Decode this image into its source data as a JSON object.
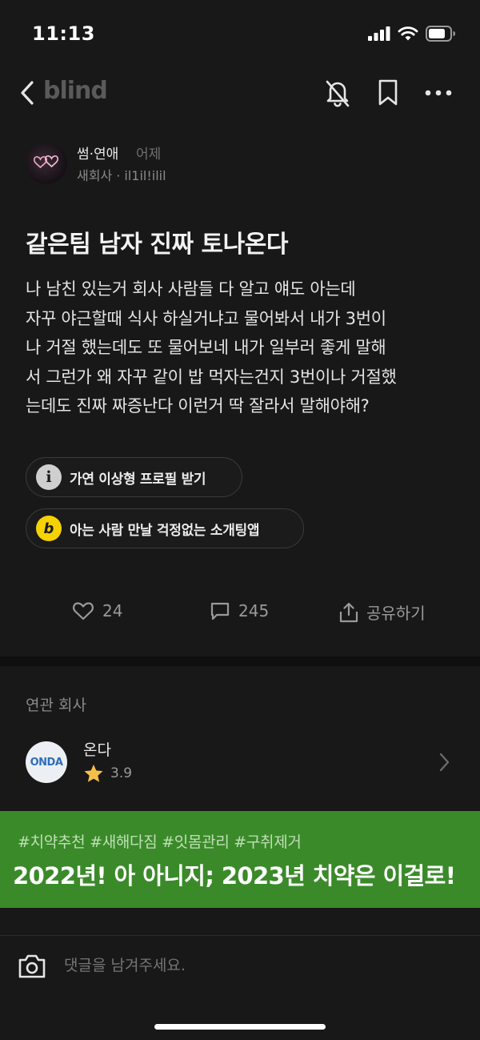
{
  "status_bar": {
    "time": "11:13"
  },
  "nav": {
    "logo": "blind"
  },
  "author": {
    "category": "썸·연애",
    "time": "어제",
    "meta": "새회사 · il1il!ilil"
  },
  "post": {
    "title": "같은팀 남자 진짜 토나온다",
    "body": "나 남친 있는거 회사 사람들 다 알고 얘도 아는데\n자꾸 야근할때 식사 하실거냐고 물어봐서 내가 3번이\n나 거절 했는데도 또 물어보네 내가 일부러 좋게 말해\n서 그런가 왜 자꾸 같이 밥 먹자는건지 3번이나 거절했\n는데도 진짜 짜증난다 이런거 딱 잘라서 말해야해?"
  },
  "promos": [
    {
      "icon": "info-icon",
      "glyph": "i",
      "label": "가연 이상형 프로필 받기"
    },
    {
      "icon": "b-logo-icon",
      "glyph": "b",
      "label": "아는 사람 만날 걱정없는 소개팅앱"
    }
  ],
  "actions": {
    "likes": "24",
    "comments": "245",
    "share_label": "공유하기"
  },
  "related": {
    "title": "연관 회사",
    "company": {
      "logo_text": "ONDA",
      "name": "온다",
      "rating": "3.9"
    }
  },
  "banner": {
    "tags": "#치약추천 #새해다짐 #잇몸관리 #구취제거",
    "headline": "2022년! 아 아니지; 2023년 치약은 이걸로!"
  },
  "comment": {
    "placeholder": "댓글을 남겨주세요."
  },
  "colors": {
    "background": "#181818",
    "banner": "#3b8a2a",
    "badge_yellow": "#f6d200",
    "star": "#f5c04a"
  }
}
